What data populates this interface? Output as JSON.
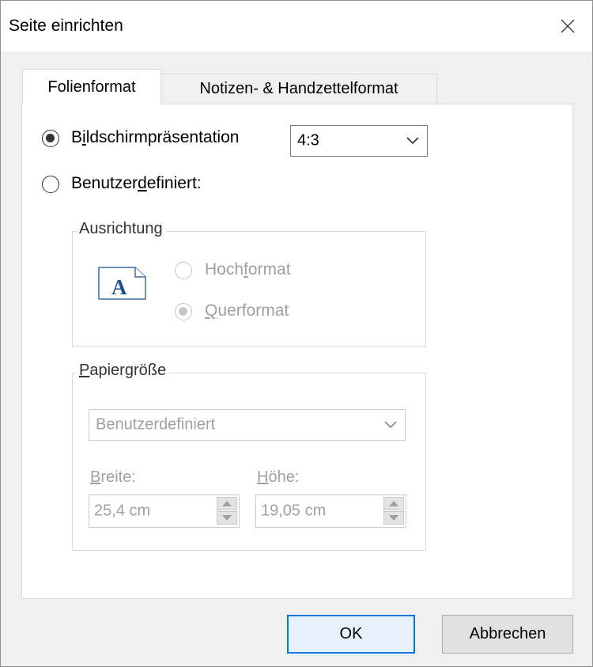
{
  "window": {
    "title": "Seite einrichten"
  },
  "tabs": [
    {
      "label": "Folienformat",
      "active": true
    },
    {
      "label": "Notizen- & Handzettelformat",
      "active": false
    }
  ],
  "slide_size": {
    "option_screen": {
      "pre": "B",
      "u": "i",
      "post": "ldschirmpräsentation",
      "checked": true
    },
    "screen_ratio": "4:3",
    "option_custom": {
      "pre": "Benutzer",
      "u": "d",
      "post": "efiniert:",
      "checked": false
    }
  },
  "orientation": {
    "title": "Ausrichtung",
    "icon_letter": "A",
    "portrait": {
      "pre": "Hoch",
      "u": "f",
      "post": "ormat",
      "checked": false
    },
    "landscape": {
      "pre": "",
      "u": "Q",
      "post": "uerformat",
      "checked": true
    }
  },
  "paper_size": {
    "title_u": "P",
    "title_rest": "apiergröße",
    "selected": "Benutzerdefiniert",
    "width": {
      "label_u": "B",
      "label_rest": "reite:",
      "value": "25,4 cm"
    },
    "height": {
      "label_u": "H",
      "label_rest": "öhe:",
      "value": "19,05 cm"
    }
  },
  "buttons": {
    "ok": "OK",
    "cancel": "Abbrechen"
  },
  "colors": {
    "accent": "#0078d7",
    "disabled_text": "#a0a0a0"
  }
}
